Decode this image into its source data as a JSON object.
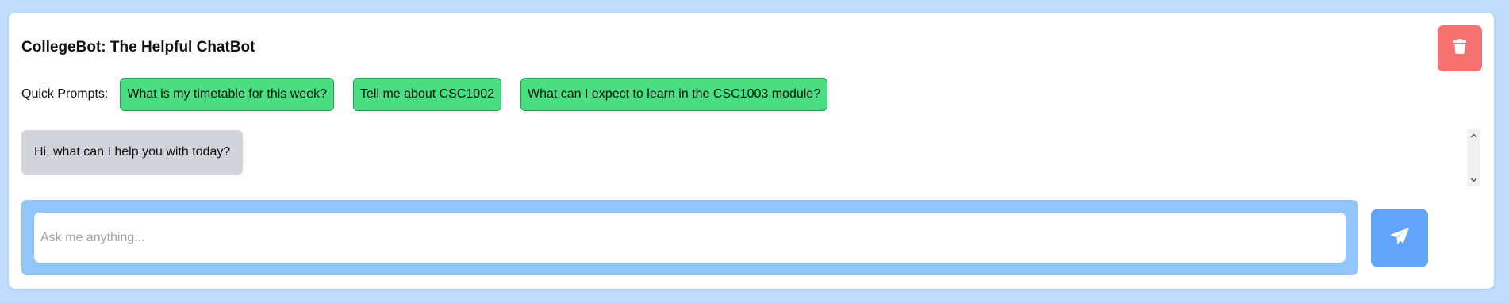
{
  "header": {
    "title": "CollegeBot: The Helpful ChatBot",
    "delete_icon": "trash-icon"
  },
  "quick_prompts": {
    "label": "Quick Prompts:",
    "items": [
      "What is my timetable for this week?",
      "Tell me about CSC1002",
      "What can I expect to learn in the CSC1003 module?"
    ]
  },
  "chat": {
    "messages": [
      {
        "role": "bot",
        "text": "Hi, what can I help you with today?"
      }
    ]
  },
  "input": {
    "placeholder": "Ask me anything...",
    "value": "",
    "send_icon": "paper-plane-icon"
  },
  "colors": {
    "page_bg": "#bfdbfe",
    "prompt_bg": "#4ade80",
    "delete_bg": "#f87171",
    "input_wrap_bg": "#93c5fd",
    "send_bg": "#60a5fa",
    "bot_bubble_bg": "#d1d5db"
  }
}
